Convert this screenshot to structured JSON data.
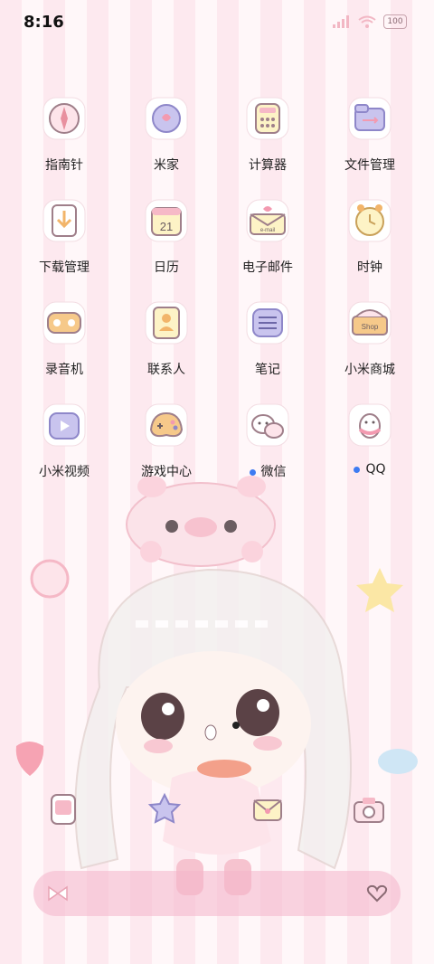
{
  "status_bar": {
    "time": "8:16",
    "battery": "100"
  },
  "apps": [
    {
      "label": "指南针",
      "icon": "compass-icon",
      "notification": false
    },
    {
      "label": "米家",
      "icon": "mihome-icon",
      "notification": false
    },
    {
      "label": "计算器",
      "icon": "calculator-icon",
      "notification": false
    },
    {
      "label": "文件管理",
      "icon": "file-manager-icon",
      "notification": false
    },
    {
      "label": "下载管理",
      "icon": "download-icon",
      "notification": false
    },
    {
      "label": "日历",
      "icon": "calendar-icon",
      "notification": false,
      "icon_text": "21"
    },
    {
      "label": "电子邮件",
      "icon": "email-icon",
      "notification": false,
      "icon_text": "e-mail"
    },
    {
      "label": "时钟",
      "icon": "clock-icon",
      "notification": false
    },
    {
      "label": "录音机",
      "icon": "recorder-icon",
      "notification": false
    },
    {
      "label": "联系人",
      "icon": "contacts-icon",
      "notification": false
    },
    {
      "label": "笔记",
      "icon": "notes-icon",
      "notification": false
    },
    {
      "label": "小米商城",
      "icon": "mi-store-icon",
      "notification": false,
      "icon_text": "Shop"
    },
    {
      "label": "小米视频",
      "icon": "video-icon",
      "notification": false
    },
    {
      "label": "游戏中心",
      "icon": "game-center-icon",
      "notification": false
    },
    {
      "label": "微信",
      "icon": "wechat-icon",
      "notification": true
    },
    {
      "label": "QQ",
      "icon": "qq-icon",
      "notification": true
    }
  ],
  "dock": [
    "phone-icon",
    "messages-icon",
    "email-dock-icon",
    "camera-icon"
  ],
  "colors": {
    "stripe_pink": "#fde9ef",
    "stripe_white": "#fff7f9",
    "notification_dot": "#3d7bf2",
    "dock": "#f4b5ca"
  }
}
